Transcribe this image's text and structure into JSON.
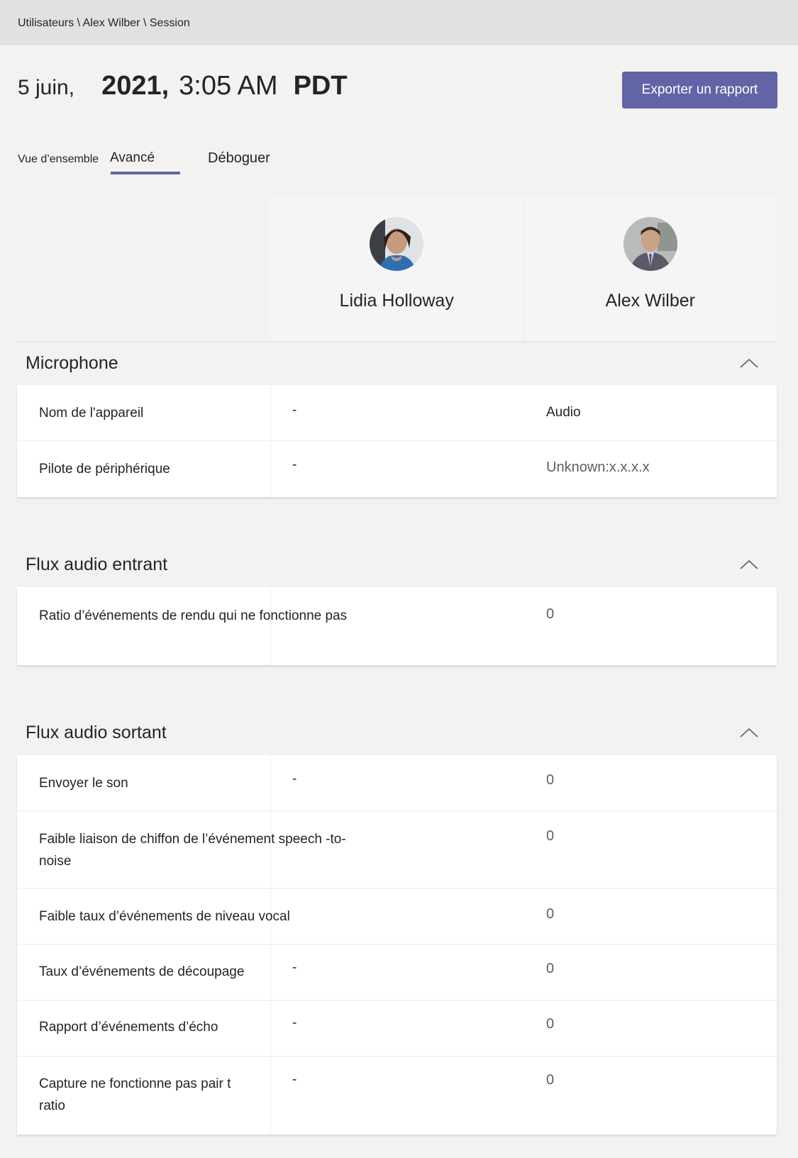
{
  "breadcrumb": "Utilisateurs \\ Alex Wilber \\ Session",
  "header": {
    "day": "5 juin,",
    "year": "2021,",
    "time": "3:05 AM",
    "tz": "PDT",
    "export_label": "Exporter un rapport"
  },
  "tabs": {
    "overview": "Vue d’ensemble",
    "advanced": "Avancé",
    "debug": "Déboguer"
  },
  "participants": [
    {
      "name": "Lidia Holloway"
    },
    {
      "name": "Alex Wilber"
    }
  ],
  "colors": {
    "accent": "#6264a7"
  },
  "sections": {
    "microphone": {
      "title": "Microphone",
      "rows": [
        {
          "label": "Nom de l'appareil",
          "v1": "-",
          "v2": "Audio"
        },
        {
          "label": "Pilote de périphérique",
          "v1": "-",
          "v2": "Unknown:x.x.x.x"
        }
      ]
    },
    "incoming": {
      "title": "Flux audio entrant",
      "rows": [
        {
          "label": "Ratio d’événements de rendu qui ne fonctionne pas",
          "v1": "",
          "v2": "0"
        }
      ]
    },
    "outgoing": {
      "title": "Flux audio sortant",
      "rows": [
        {
          "label": "Envoyer le son",
          "v1": "-",
          "v2": "0"
        },
        {
          "label": "Faible liaison de chiffon de l’événement speech -to-noise",
          "v1": "",
          "v2": "0"
        },
        {
          "label": "Faible taux d’événements de niveau vocal",
          "v1": "",
          "v2": "0"
        },
        {
          "label": "Taux d’événements de découpage",
          "v1": "-",
          "v2": "0"
        },
        {
          "label": "Rapport d’événements d’écho",
          "v1": "-",
          "v2": "0"
        },
        {
          "label": "Capture ne fonctionne pas pair t ratio",
          "v1": "-",
          "v2": "0"
        }
      ]
    }
  }
}
